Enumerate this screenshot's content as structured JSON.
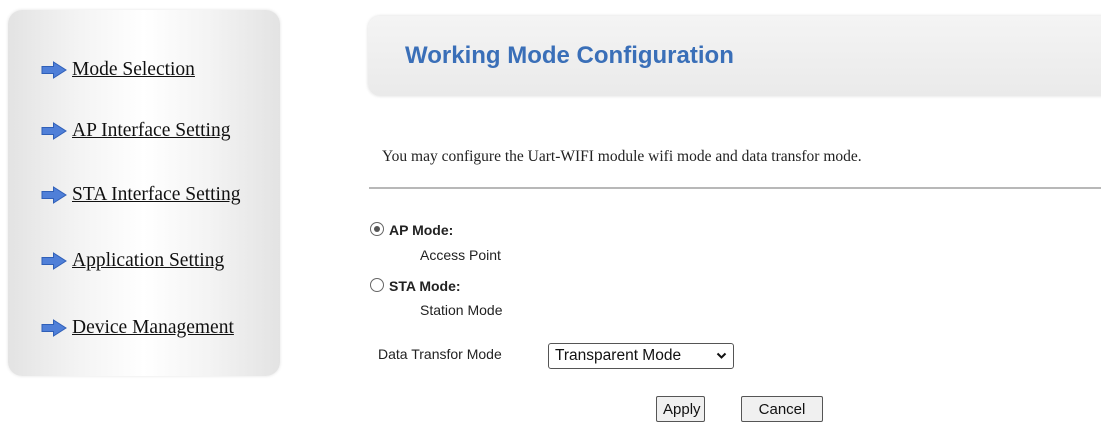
{
  "sidebar": {
    "items": [
      {
        "label": "Mode Selection",
        "icon": "arrow-right-icon"
      },
      {
        "label": "AP Interface Setting",
        "icon": "arrow-right-icon"
      },
      {
        "label": "STA Interface Setting",
        "icon": "arrow-right-icon"
      },
      {
        "label": "Application Setting",
        "icon": "arrow-right-icon"
      },
      {
        "label": "Device Management",
        "icon": "arrow-right-icon"
      }
    ]
  },
  "header": {
    "title": "Working Mode Configuration"
  },
  "description": "You may configure the Uart-WIFI module wifi mode and data transfor mode.",
  "modes": {
    "ap": {
      "title": "AP Mode:",
      "subtitle": "Access Point",
      "checked": true
    },
    "sta": {
      "title": "STA Mode:",
      "subtitle": "Station Mode",
      "checked": false
    }
  },
  "data_transfor": {
    "label": "Data Transfor Mode",
    "selected": "Transparent Mode"
  },
  "buttons": {
    "apply": "Apply",
    "cancel": "Cancel"
  },
  "colors": {
    "title_blue": "#3a6fb8",
    "arrow_blue": "#4f7fd8"
  }
}
